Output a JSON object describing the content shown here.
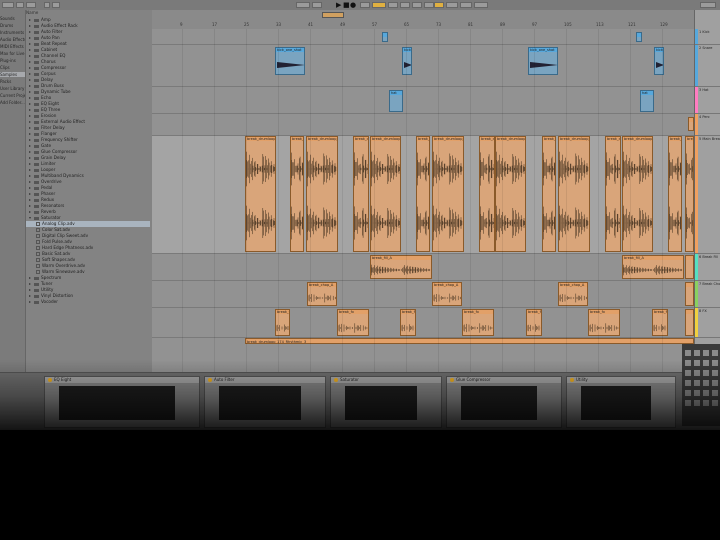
{
  "transport": {
    "glyphs": [
      "▶",
      "■",
      "●"
    ]
  },
  "browser": {
    "places": [
      "Sounds",
      "Drums",
      "Instruments",
      "Audio Effects",
      "MIDI Effects",
      "Max for Live",
      "Plug-ins",
      "Clips",
      "Samples",
      "Packs",
      "User Library",
      "Current Project",
      "Add Folder..."
    ],
    "header": "Name",
    "items": [
      {
        "label": "Amp",
        "type": "folder"
      },
      {
        "label": "Audio Effect Rack",
        "type": "folder"
      },
      {
        "label": "Auto Filter",
        "type": "folder"
      },
      {
        "label": "Auto Pan",
        "type": "folder"
      },
      {
        "label": "Beat Repeat",
        "type": "folder"
      },
      {
        "label": "Cabinet",
        "type": "folder"
      },
      {
        "label": "Channel EQ",
        "type": "folder"
      },
      {
        "label": "Chorus",
        "type": "folder"
      },
      {
        "label": "Compressor",
        "type": "folder"
      },
      {
        "label": "Corpus",
        "type": "folder"
      },
      {
        "label": "Delay",
        "type": "folder"
      },
      {
        "label": "Drum Buss",
        "type": "folder"
      },
      {
        "label": "Dynamic Tube",
        "type": "folder"
      },
      {
        "label": "Echo",
        "type": "folder"
      },
      {
        "label": "EQ Eight",
        "type": "folder"
      },
      {
        "label": "EQ Three",
        "type": "folder"
      },
      {
        "label": "Erosion",
        "type": "folder"
      },
      {
        "label": "External Audio Effect",
        "type": "folder"
      },
      {
        "label": "Filter Delay",
        "type": "folder"
      },
      {
        "label": "Flanger",
        "type": "folder"
      },
      {
        "label": "Frequency Shifter",
        "type": "folder"
      },
      {
        "label": "Gate",
        "type": "folder"
      },
      {
        "label": "Glue Compressor",
        "type": "folder"
      },
      {
        "label": "Grain Delay",
        "type": "folder"
      },
      {
        "label": "Limiter",
        "type": "folder"
      },
      {
        "label": "Looper",
        "type": "folder"
      },
      {
        "label": "Multiband Dynamics",
        "type": "folder"
      },
      {
        "label": "Overdrive",
        "type": "folder"
      },
      {
        "label": "Pedal",
        "type": "folder"
      },
      {
        "label": "Phaser",
        "type": "folder"
      },
      {
        "label": "Redux",
        "type": "folder"
      },
      {
        "label": "Resonators",
        "type": "folder"
      },
      {
        "label": "Reverb",
        "type": "folder"
      },
      {
        "label": "Saturator",
        "type": "folder",
        "open": true
      },
      {
        "label": "Analog Clip.adv",
        "type": "file",
        "selected": true
      },
      {
        "label": "Color Sat.adv",
        "type": "file"
      },
      {
        "label": "Digital Clip Sweet.adv",
        "type": "file"
      },
      {
        "label": "Fold Pulse.adv",
        "type": "file"
      },
      {
        "label": "Hard Edge Phatness.adv",
        "type": "file"
      },
      {
        "label": "Basic Sat.adv",
        "type": "file"
      },
      {
        "label": "Soft Shaper.adv",
        "type": "file"
      },
      {
        "label": "Warm Overdrive.adv",
        "type": "file"
      },
      {
        "label": "Warm Sinewave.adv",
        "type": "file"
      },
      {
        "label": "Spectrum",
        "type": "folder"
      },
      {
        "label": "Tuner",
        "type": "folder"
      },
      {
        "label": "Utility",
        "type": "folder"
      },
      {
        "label": "Vinyl Distortion",
        "type": "folder"
      },
      {
        "label": "Vocoder",
        "type": "folder"
      }
    ]
  },
  "ruler": {
    "bars": [
      "9",
      "17",
      "25",
      "33",
      "41",
      "49",
      "57",
      "65",
      "73",
      "81",
      "89",
      "97",
      "105",
      "113",
      "121",
      "129"
    ]
  },
  "tracks": [
    {
      "name": "1 Kick",
      "color": "#56a8dc",
      "clips": []
    },
    {
      "name": "2 Snare",
      "color": "#56a8dc",
      "clips": [
        {
          "label": "kick_one_shot",
          "start": 120,
          "width": 38
        }
      ]
    },
    {
      "name": "3 Hat",
      "color": "#ff7cc0",
      "clips": [
        {
          "label": "hat",
          "start": 237,
          "width": 12
        }
      ]
    },
    {
      "name": "4 Perc",
      "color": "#f0a060",
      "clips": []
    },
    {
      "name": "5 Main Break",
      "color": "#f0a060",
      "clips": []
    },
    {
      "name": "6 Break Fill",
      "color": "#56e0c0",
      "clips": [
        {
          "label": "break_fill_A",
          "start": 218,
          "width": 62
        }
      ]
    },
    {
      "name": "7 Break Chop",
      "color": "#8ad060",
      "clips": [
        {
          "label": "break_chop_A",
          "start": 155,
          "width": 30
        }
      ]
    },
    {
      "name": "8 FX",
      "color": "#f0d040",
      "clips": [
        {
          "label": "break_fx",
          "start": 185,
          "width": 62
        }
      ]
    }
  ],
  "bottom_clip_label": "break_drumloop_174_Rhythmic_3",
  "devices": [
    {
      "name": "EQ Eight"
    },
    {
      "name": "Auto Filter"
    },
    {
      "name": "Saturator"
    },
    {
      "name": "Glue Compressor"
    },
    {
      "name": "Utility"
    }
  ]
}
